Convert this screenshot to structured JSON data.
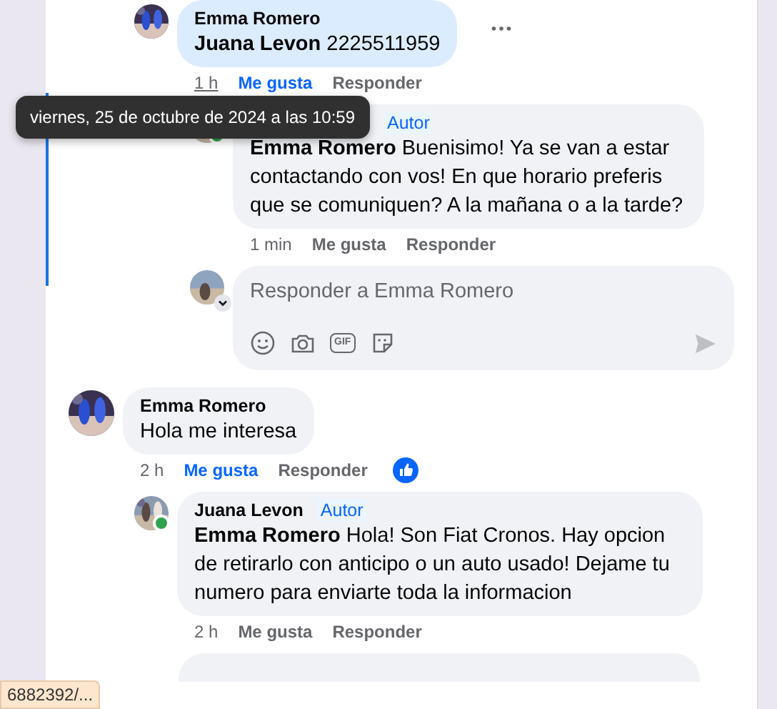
{
  "threads": [
    {
      "kind": "continuation",
      "children": [
        {
          "kind": "comment",
          "author": "Emma Romero",
          "mention": "Juana Levon",
          "text": "2225511959",
          "time": "1 h",
          "like_label": "Me gusta",
          "like_selected": true,
          "reply_label": "Responder",
          "highlighted": true,
          "online": false,
          "has_menu": true,
          "reacted": false,
          "children": [
            {
              "kind": "comment",
              "badge": "Autor",
              "mention": "Emma Romero",
              "text": "Buenisimo! Ya se van a estar contactando con vos! En que horario preferis que se comuniquen? A la mañana o a la tarde?",
              "time": "1 min",
              "like_label": "Me gusta",
              "like_selected": false,
              "reply_label": "Responder",
              "highlighted": false,
              "online": true,
              "has_menu": false,
              "reacted": false
            },
            {
              "kind": "composer",
              "placeholder": "Responder a Emma Romero",
              "gif_label": "GIF"
            }
          ]
        }
      ]
    },
    {
      "kind": "comment",
      "author": "Emma Romero",
      "text": "Hola me interesa",
      "time": "2 h",
      "like_label": "Me gusta",
      "like_selected": true,
      "reply_label": "Responder",
      "highlighted": false,
      "online": false,
      "has_menu": false,
      "reacted": true,
      "children": [
        {
          "kind": "comment",
          "author": "Juana Levon",
          "badge": "Autor",
          "mention": "Emma Romero",
          "text": "Hola! Son Fiat Cronos. Hay opcion de retirarlo con anticipo o un auto usado! Dejame tu numero para enviarte toda la informacion",
          "time": "2 h",
          "like_label": "Me gusta",
          "like_selected": false,
          "reply_label": "Responder",
          "highlighted": false,
          "online": true,
          "has_menu": false,
          "reacted": false
        },
        {
          "kind": "cut"
        }
      ]
    }
  ],
  "tooltip": "viernes, 25 de octubre de 2024 a las 10:59",
  "status_url": "6882392/..."
}
